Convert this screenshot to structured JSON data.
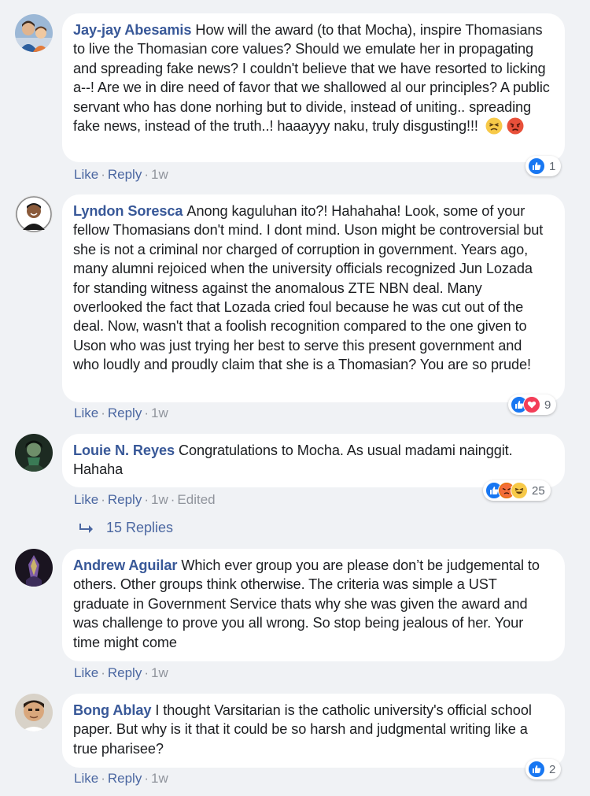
{
  "comments": [
    {
      "author": "Jay-jay Abesamis",
      "text": "How will the award (to that Mocha), inspire Thomasians to live the Thomasian core values? Should we emulate her in propagating and spreading fake news? I couldn't believe that we have resorted to licking a--! Are we in dire need of favor that we shallowed al our principles? A public servant who has done norhing but to divide, instead of uniting.. spreading fake news, instead of the truth..! haaayyy naku, truly disgusting!!!",
      "emoji": [
        "persevering-face",
        "angry-face"
      ],
      "like": "Like",
      "reply": "Reply",
      "time": "1w",
      "reaction_count": "1",
      "reaction_types": [
        "like"
      ]
    },
    {
      "author": "Lyndon Soresca",
      "text": "Anong kaguluhan ito?! Hahahaha! Look, some of your fellow Thomasians don't mind. I dont mind. Uson might be controversial but she is not a criminal nor charged of corruption in government. Years ago, many alumni rejoiced when the university officials recognized Jun Lozada for standing witness against the anomalous ZTE NBN deal. Many overlooked the fact that Lozada cried foul because he was cut out of the deal. Now, wasn't that a foolish recognition compared to the one given to Uson who was just trying her best to serve this present government and who loudly and proudly claim that she is a Thomasian? You are so prude!",
      "like": "Like",
      "reply": "Reply",
      "time": "1w",
      "reaction_count": "9",
      "reaction_types": [
        "like",
        "love"
      ]
    },
    {
      "author": "Louie N. Reyes",
      "text": "Congratulations to Mocha. As usual madami nainggit. Hahaha",
      "like": "Like",
      "reply": "Reply",
      "time": "1w",
      "edited": "Edited",
      "reaction_count": "25",
      "reaction_types": [
        "like",
        "angry",
        "haha"
      ],
      "replies_label": "15 Replies"
    },
    {
      "author": "Andrew Aguilar",
      "text": "Which ever group you are please don’t be judgemental to others. Other groups think otherwise. The criteria was simple a UST graduate in Government Service thats why she was given the award and was challenge to prove you all wrong. So stop being jealous of her. Your time might come",
      "like": "Like",
      "reply": "Reply",
      "time": "1w"
    },
    {
      "author": "Bong Ablay",
      "text": "I thought Varsitarian is the catholic university's official school paper. But why is it that it could be so harsh and judgmental writing like a true pharisee?",
      "like": "Like",
      "reply": "Reply",
      "time": "1w",
      "reaction_count": "2",
      "reaction_types": [
        "like"
      ]
    }
  ],
  "colors": {
    "author": "#385898",
    "link": "#4b67a1",
    "meta": "#90949c",
    "like_blue": "#1877f2",
    "love_red": "#f33e58",
    "bubble": "#ffffff",
    "background": "#f0f2f5"
  }
}
